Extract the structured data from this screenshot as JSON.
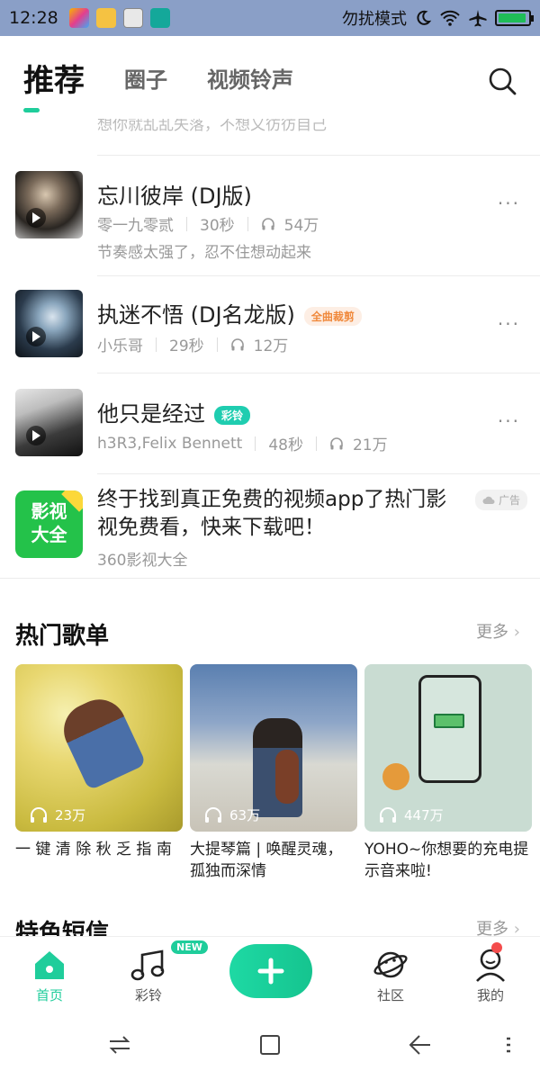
{
  "status_bar": {
    "time": "12:28",
    "dnd_label": "勿扰模式",
    "battery_level": 0.95
  },
  "tabs": [
    {
      "label": "推荐",
      "active": true
    },
    {
      "label": "圈子",
      "active": false
    },
    {
      "label": "视频铃声",
      "active": false
    }
  ],
  "cut_text": "想你就乱乱失落，不想又彷彷自己",
  "songs": [
    {
      "title": "忘川彼岸 (DJ版)",
      "tag": "",
      "artist": "零一九零贰",
      "duration": "30秒",
      "plays": "54万",
      "desc": "节奏感太强了，忍不住想动起来",
      "more": "···"
    },
    {
      "title": "执迷不悟 (DJ名龙版)",
      "tag": "全曲裁剪",
      "artist": "小乐哥",
      "duration": "29秒",
      "plays": "12万",
      "desc": "",
      "more": "···"
    },
    {
      "title": "他只是经过",
      "tag": "彩铃",
      "artist": "h3R3,Felix Bennett",
      "duration": "48秒",
      "plays": "21万",
      "desc": "",
      "more": "···"
    }
  ],
  "ad": {
    "logo_line1": "影视",
    "logo_line2": "大全",
    "title": "终于找到真正免费的视频app了热门影视免费看，快来下载吧！",
    "source": "360影视大全",
    "badge": "广告"
  },
  "hot_playlists": {
    "title": "热门歌单",
    "more": "更多",
    "items": [
      {
        "count": "23万",
        "title": "一 键 清 除 秋 乏 指 南"
      },
      {
        "count": "63万",
        "title": "大提琴篇 | 唤醒灵魂，孤独而深情"
      },
      {
        "count": "447万",
        "title": "YOHO~你想要的充电提示音来啦!"
      }
    ]
  },
  "next_section": {
    "title": "特色短信",
    "more": "更多"
  },
  "bottom_nav": {
    "home": "首页",
    "ringtone": "彩铃",
    "new_badge": "NEW",
    "community": "社区",
    "mine": "我的"
  },
  "colors": {
    "accent": "#1fcd9b",
    "status_bar": "#8a9fc7"
  }
}
